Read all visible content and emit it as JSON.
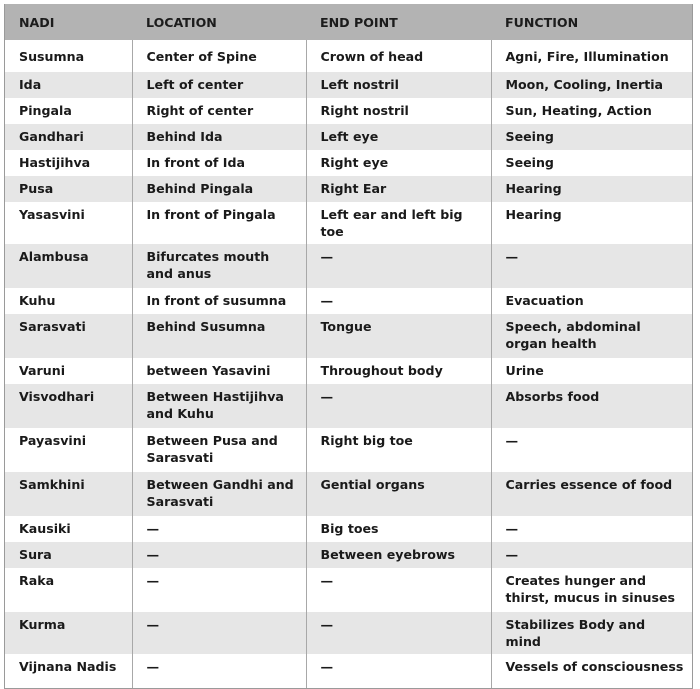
{
  "table": {
    "headers": [
      "NADI",
      "LOCATION",
      "END POINT",
      "FUNCTION"
    ],
    "rows": [
      {
        "nadi": "Susumna",
        "location": "Center of Spine",
        "end_point": "Crown of head",
        "function": "Agni, Fire, Illumination"
      },
      {
        "nadi": "Ida",
        "location": "Left of center",
        "end_point": "Left nostril",
        "function": "Moon, Cooling, Inertia"
      },
      {
        "nadi": "Pingala",
        "location": "Right of center",
        "end_point": "Right nostril",
        "function": "Sun, Heating, Action"
      },
      {
        "nadi": "Gandhari",
        "location": "Behind Ida",
        "end_point": "Left eye",
        "function": "Seeing"
      },
      {
        "nadi": "Hastijihva",
        "location": "In front of Ida",
        "end_point": "Right eye",
        "function": "Seeing"
      },
      {
        "nadi": "Pusa",
        "location": "Behind Pingala",
        "end_point": "Right Ear",
        "function": "Hearing"
      },
      {
        "nadi": "Yasasvini",
        "location": "In front of Pingala",
        "end_point": "Left ear and left big toe",
        "function": "Hearing"
      },
      {
        "nadi": "Alambusa",
        "location": "Bifurcates mouth and anus",
        "end_point": "—",
        "function": "—"
      },
      {
        "nadi": "Kuhu",
        "location": "In front of susumna",
        "end_point": "—",
        "function": "Evacuation"
      },
      {
        "nadi": "Sarasvati",
        "location": "Behind Susumna",
        "end_point": "Tongue",
        "function": "Speech, abdominal organ health"
      },
      {
        "nadi": "Varuni",
        "location": "between Yasavini",
        "end_point": "Throughout body",
        "function": "Urine"
      },
      {
        "nadi": "Visvodhari",
        "location": "Between Hastijihva and Kuhu",
        "end_point": "—",
        "function": "Absorbs food"
      },
      {
        "nadi": "Payasvini",
        "location": "Between Pusa and Sarasvati",
        "end_point": "Right big toe",
        "function": "—"
      },
      {
        "nadi": "Samkhini",
        "location": "Between Gandhi and Sarasvati",
        "end_point": "Gential organs",
        "function": "Carries essence of food"
      },
      {
        "nadi": "Kausiki",
        "location": "—",
        "end_point": "Big toes",
        "function": "—"
      },
      {
        "nadi": "Sura",
        "location": "—",
        "end_point": "Between eyebrows",
        "function": "—"
      },
      {
        "nadi": "Raka",
        "location": "—",
        "end_point": "—",
        "function": "Creates hunger and thirst, mucus in sinuses"
      },
      {
        "nadi": "Kurma",
        "location": "—",
        "end_point": "—",
        "function": "Stabilizes Body and mind"
      },
      {
        "nadi": "Vijnana Nadis",
        "location": "—",
        "end_point": "—",
        "function": "Vessels of consciousness"
      }
    ]
  }
}
